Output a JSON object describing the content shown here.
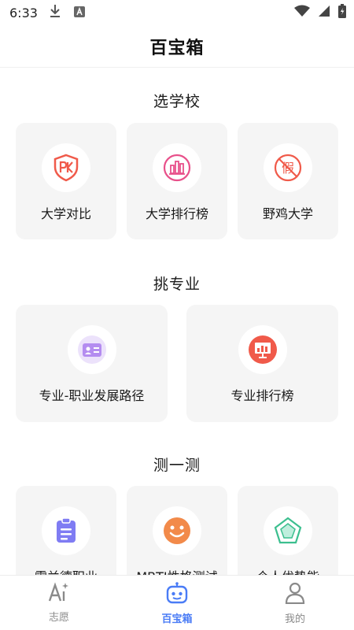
{
  "status_bar": {
    "time": "6:33",
    "icons": [
      "download-icon",
      "keyboard-a-icon",
      "wifi-icon",
      "signal-icon",
      "battery-icon"
    ]
  },
  "header": {
    "title": "百宝箱"
  },
  "sections": [
    {
      "title": "选学校",
      "cards": [
        {
          "label": "大学对比",
          "icon": "pk-shield-icon",
          "color": "#f05a4a"
        },
        {
          "label": "大学排行榜",
          "icon": "ranking-chart-icon",
          "color": "#e8508a"
        },
        {
          "label": "野鸡大学",
          "icon": "fake-forbidden-icon",
          "color": "#f05a4a"
        }
      ]
    },
    {
      "title": "挑专业",
      "cards": [
        {
          "label": "专业-职业发展路径",
          "icon": "id-card-icon",
          "color": "#b48cf0"
        },
        {
          "label": "专业排行榜",
          "icon": "presentation-chart-icon",
          "color": "#f05a4a"
        }
      ]
    },
    {
      "title": "测一测",
      "cards": [
        {
          "label": "霍兰德职业",
          "icon": "clipboard-icon",
          "color": "#7f7cf3"
        },
        {
          "label": "MBTI性格测试",
          "icon": "smiley-icon",
          "color": "#f28a4a"
        },
        {
          "label": "个人优势能",
          "icon": "pentagon-radar-icon",
          "color": "#3cbf8f"
        }
      ]
    }
  ],
  "bottom_nav": {
    "items": [
      {
        "label": "志愿",
        "icon": "ai-sparkle-icon",
        "active": false
      },
      {
        "label": "百宝箱",
        "icon": "robot-box-icon",
        "active": true
      },
      {
        "label": "我的",
        "icon": "user-icon",
        "active": false
      }
    ],
    "active_color": "#4a7cf6",
    "inactive_color": "#8a8a8a"
  }
}
